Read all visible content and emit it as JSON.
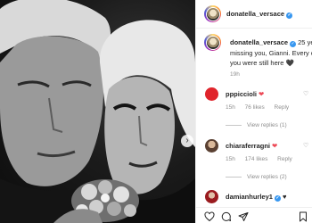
{
  "post": {
    "username": "donatella_versace",
    "verified_mark": "✓",
    "more_label": "•••",
    "caption_lines": [
      "25 years",
      "missing you, Gianni. Every day",
      "you were still here"
    ],
    "caption_heart": "🖤",
    "timestamp": "19h"
  },
  "comments": [
    {
      "username": "pppiccioli",
      "text": "",
      "heart": "❤",
      "time": "15h",
      "likes": "76 likes",
      "reply": "Reply",
      "view_replies": "View replies (1)",
      "avatar_color": "#e0242b"
    },
    {
      "username": "chiaraferragni",
      "text": "",
      "heart": "❤",
      "time": "15h",
      "likes": "174 likes",
      "reply": "Reply",
      "view_replies": "View replies (2)",
      "avatar_color": "#7a5a48"
    },
    {
      "username": "damianhurley1",
      "text": "",
      "heart": "♥",
      "avatar_color": "#9a1b1f"
    }
  ],
  "icons": {
    "like": "heart-outline-icon",
    "comment": "comment-icon",
    "share": "share-icon",
    "save": "bookmark-icon",
    "next": "chevron-right-icon",
    "comment_like": "heart-outline-icon"
  },
  "colors": {
    "verified": "#3897f0",
    "heart_red": "#ed4956",
    "muted": "#8e8e8e"
  }
}
